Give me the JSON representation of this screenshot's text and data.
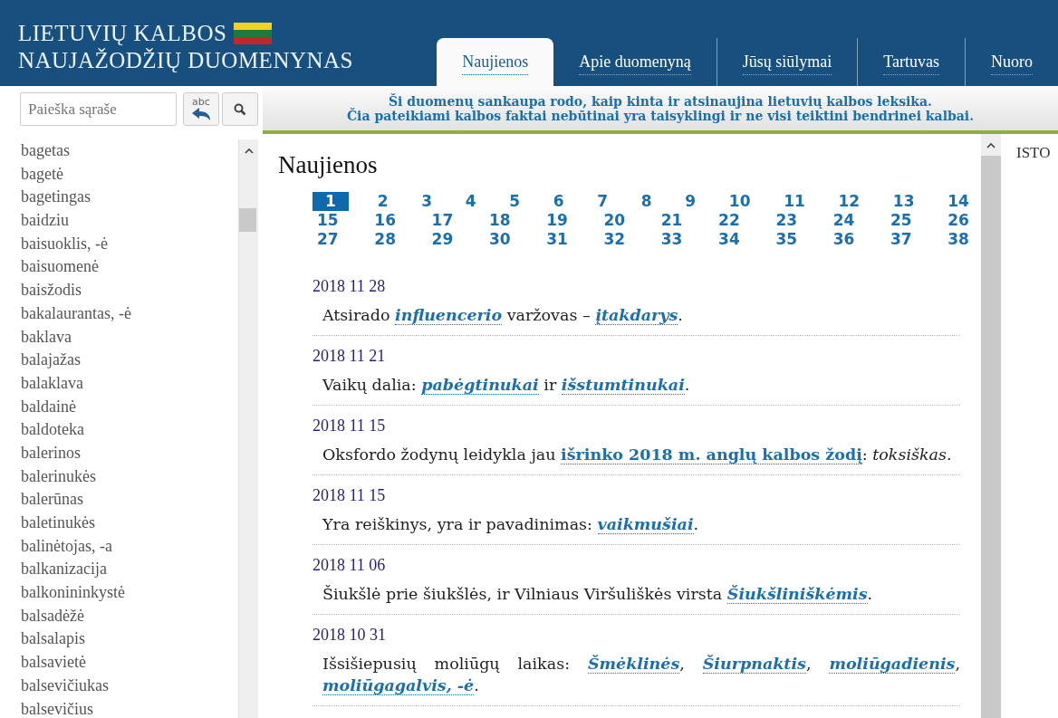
{
  "site_title": [
    "LIETUVIŲ KALBOS",
    "NAUJAŽODŽIŲ DUOMENYNAS"
  ],
  "tabs": [
    {
      "label": "Naujienos",
      "selected": true
    },
    {
      "label": "Apie duomenyną",
      "selected": false
    },
    {
      "label": "Jūsų siūlymai",
      "selected": false
    },
    {
      "label": "Tartuvas",
      "selected": false
    },
    {
      "label": "Nuoro",
      "selected": false
    }
  ],
  "search": {
    "placeholder": "Paieška sąraše",
    "spell_label": "abc"
  },
  "banner": [
    "Ši duomenų sankaupa rodo, kaip kinta ir atsinaujina lietuvių kalbos leksika.",
    "Čia pateikiami kalbos faktai nebūtinai yra taisyklingi ir ne visi teiktini bendrinei kalbai."
  ],
  "word_list": [
    "bagetas",
    "bagetė",
    "bagetingas",
    "baidziu",
    "baisuoklis, -ė",
    "baisuomenė",
    "baisžodis",
    "bakalaurantas, -ė",
    "baklava",
    "balajažas",
    "balaklava",
    "baldainė",
    "baldoteka",
    "balerinos",
    "balerinukės",
    "balerūnas",
    "baletinukės",
    "balinėtojas, -a",
    "balkanizacija",
    "balkonininkystė",
    "balsadėžė",
    "balsalapis",
    "balsavietė",
    "balsevičiukas",
    "balsevičius"
  ],
  "main": {
    "heading": "Naujienos",
    "pages": [
      {
        "label": "1",
        "selected": true
      },
      {
        "label": "2",
        "selected": false
      },
      {
        "label": "3",
        "selected": false
      },
      {
        "label": "4",
        "selected": false
      },
      {
        "label": "5",
        "selected": false
      },
      {
        "label": "6",
        "selected": false
      },
      {
        "label": "7",
        "selected": false
      },
      {
        "label": "8",
        "selected": false
      },
      {
        "label": "9",
        "selected": false
      },
      {
        "label": "10",
        "selected": false
      },
      {
        "label": "11",
        "selected": false
      },
      {
        "label": "12",
        "selected": false
      },
      {
        "label": "13",
        "selected": false
      },
      {
        "label": "14",
        "selected": false
      },
      {
        "label": "15",
        "selected": false
      },
      {
        "label": "16",
        "selected": false
      },
      {
        "label": "17",
        "selected": false
      },
      {
        "label": "18",
        "selected": false
      },
      {
        "label": "19",
        "selected": false
      },
      {
        "label": "20",
        "selected": false
      },
      {
        "label": "21",
        "selected": false
      },
      {
        "label": "22",
        "selected": false
      },
      {
        "label": "23",
        "selected": false
      },
      {
        "label": "24",
        "selected": false
      },
      {
        "label": "25",
        "selected": false
      },
      {
        "label": "26",
        "selected": false
      },
      {
        "label": "27",
        "selected": false
      },
      {
        "label": "28",
        "selected": false
      },
      {
        "label": "29",
        "selected": false
      },
      {
        "label": "30",
        "selected": false
      },
      {
        "label": "31",
        "selected": false
      },
      {
        "label": "32",
        "selected": false
      },
      {
        "label": "33",
        "selected": false
      },
      {
        "label": "34",
        "selected": false
      },
      {
        "label": "35",
        "selected": false
      },
      {
        "label": "36",
        "selected": false
      },
      {
        "label": "37",
        "selected": false
      },
      {
        "label": "38",
        "selected": false
      }
    ],
    "news": [
      {
        "date": "2018 11 28",
        "parts": [
          {
            "kind": "text",
            "text": "Atsirado "
          },
          {
            "kind": "term-link",
            "text": "influencerio"
          },
          {
            "kind": "text",
            "text": " varžovas – "
          },
          {
            "kind": "term-link",
            "text": "įtakdarys"
          },
          {
            "kind": "text",
            "text": "."
          }
        ]
      },
      {
        "date": "2018 11 21",
        "parts": [
          {
            "kind": "text",
            "text": "Vaikų dalia: "
          },
          {
            "kind": "term-link",
            "text": "pabėgtinukai"
          },
          {
            "kind": "text",
            "text": " ir "
          },
          {
            "kind": "term-link",
            "text": "išstumtinukai"
          },
          {
            "kind": "text",
            "text": "."
          }
        ]
      },
      {
        "date": "2018 11 15",
        "parts": [
          {
            "kind": "text",
            "text": "Oksfordo žodynų leidykla jau "
          },
          {
            "kind": "link",
            "text": "išrinko 2018 m. anglų kalbos žodį"
          },
          {
            "kind": "text",
            "text": ": "
          },
          {
            "kind": "italic",
            "text": "toksiškas"
          },
          {
            "kind": "text",
            "text": "."
          }
        ]
      },
      {
        "date": "2018 11 15",
        "parts": [
          {
            "kind": "text",
            "text": "Yra reiškinys, yra ir pavadinimas: "
          },
          {
            "kind": "term-link",
            "text": "vaikmušiai"
          },
          {
            "kind": "text",
            "text": "."
          }
        ]
      },
      {
        "date": "2018 11 06",
        "parts": [
          {
            "kind": "text",
            "text": "Šiukšlė prie šiukšlės, ir Vilniaus Viršuliškės virsta "
          },
          {
            "kind": "term-link",
            "text": "Šiukšliniškėmis"
          },
          {
            "kind": "text",
            "text": "."
          }
        ]
      },
      {
        "date": "2018 10 31",
        "parts": [
          {
            "kind": "text",
            "text": "Išsišiepusių moliūgų laikas: "
          },
          {
            "kind": "term-link",
            "text": "Šmėklinės"
          },
          {
            "kind": "text",
            "text": ", "
          },
          {
            "kind": "term-link",
            "text": "Šiurpnaktis"
          },
          {
            "kind": "text",
            "text": ", "
          },
          {
            "kind": "term-link",
            "text": "moliūgadienis"
          },
          {
            "kind": "text",
            "text": ", "
          },
          {
            "kind": "term-link",
            "text": "moliūgagalvis, -ė"
          },
          {
            "kind": "text",
            "text": "."
          }
        ]
      }
    ]
  },
  "right_panel": {
    "heading": "ISTO"
  }
}
